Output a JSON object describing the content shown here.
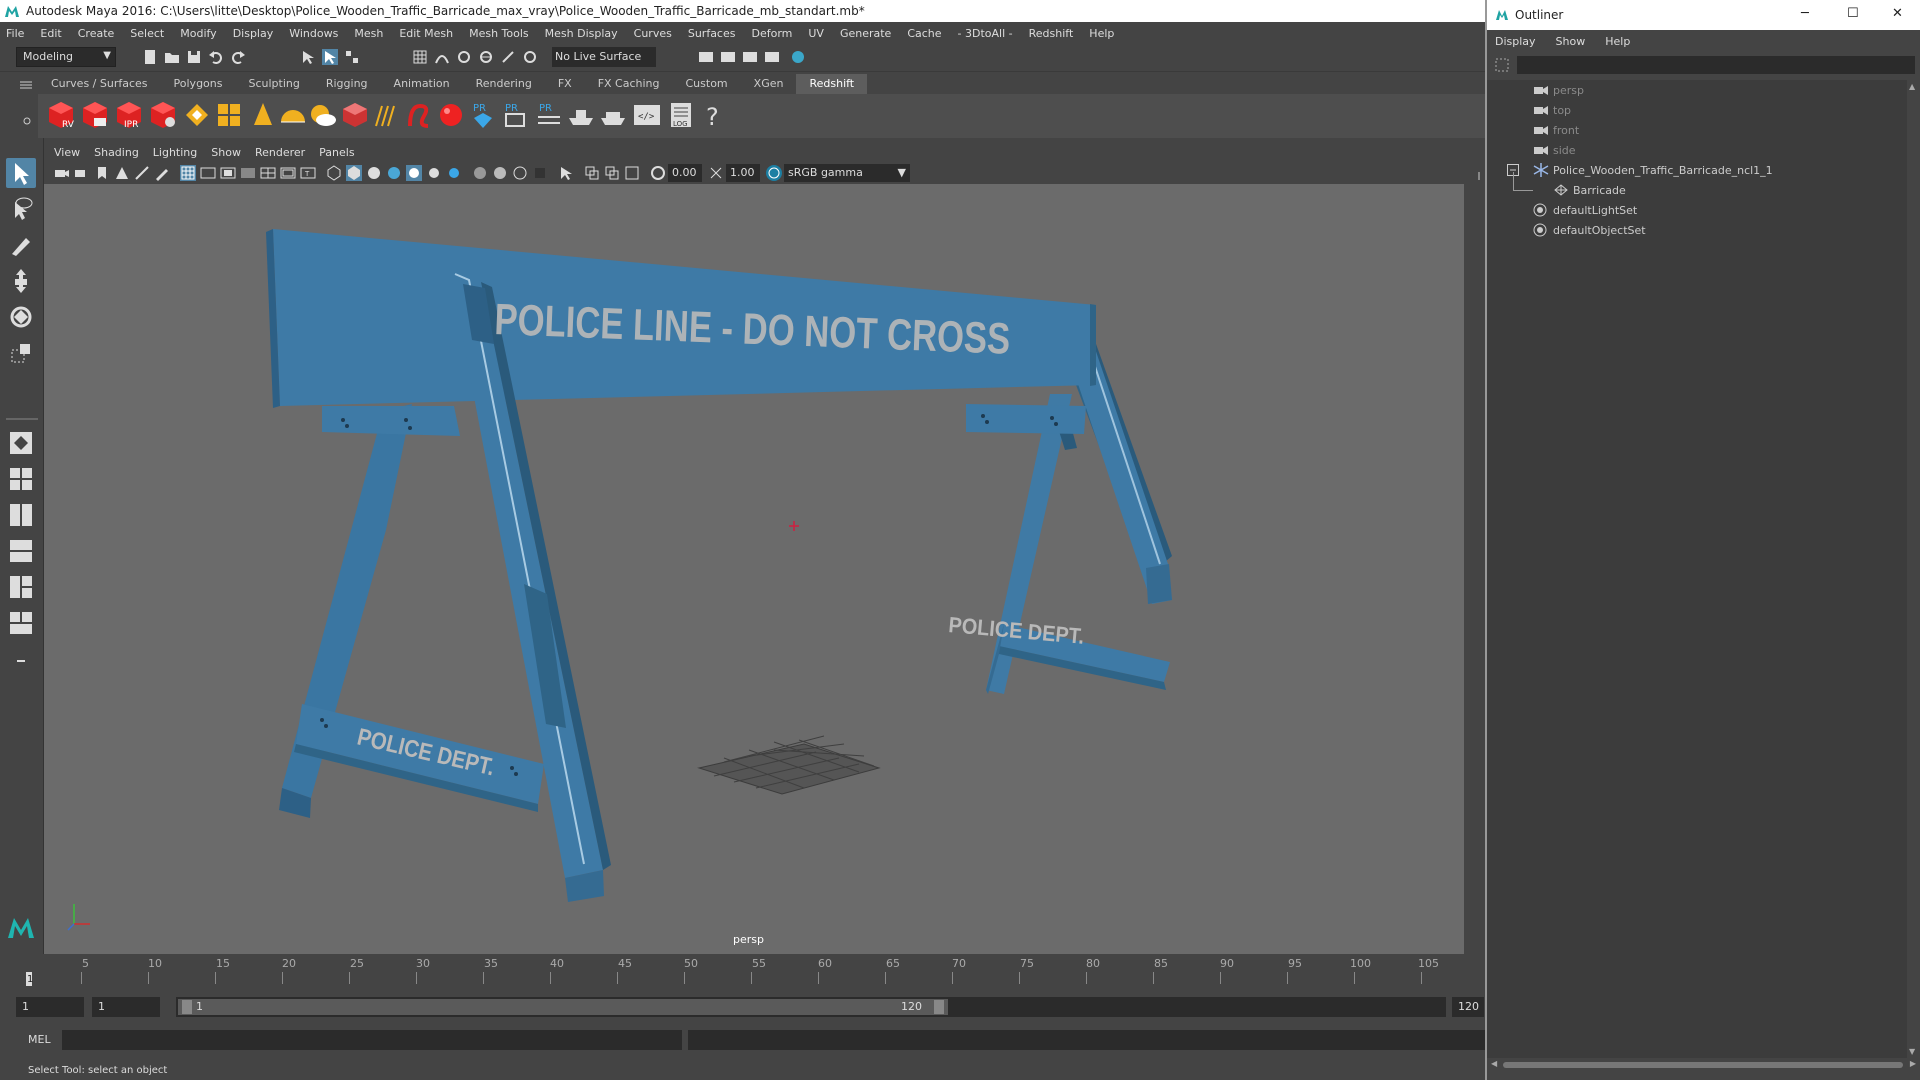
{
  "window": {
    "title": "Autodesk Maya 2016: C:\\Users\\litte\\Desktop\\Police_Wooden_Traffic_Barricade_max_vray\\Police_Wooden_Traffic_Barricade_mb_standart.mb*"
  },
  "menubar": [
    "File",
    "Edit",
    "Create",
    "Select",
    "Modify",
    "Display",
    "Windows",
    "Mesh",
    "Edit Mesh",
    "Mesh Tools",
    "Mesh Display",
    "Curves",
    "Surfaces",
    "Deform",
    "UV",
    "Generate",
    "Cache",
    "- 3DtoAll -",
    "Redshift",
    "Help"
  ],
  "statusline": {
    "mode": "Modeling",
    "live_surface": "No Live Surface"
  },
  "shelf": {
    "tabs": [
      "Curves / Surfaces",
      "Polygons",
      "Sculpting",
      "Rigging",
      "Animation",
      "Rendering",
      "FX",
      "FX Caching",
      "Custom",
      "XGen",
      "Redshift"
    ],
    "active_tab": "Redshift"
  },
  "panel": {
    "menus": [
      "View",
      "Shading",
      "Lighting",
      "Show",
      "Renderer",
      "Panels"
    ],
    "exposure": "0.00",
    "gamma": "1.00",
    "color_space": "sRGB gamma",
    "camera_label": "persp"
  },
  "barricade": {
    "plank_text": "POLICE LINE - DO NOT CROSS",
    "foot_text": "POLICE DEPT.",
    "color": "#3e7aa6"
  },
  "timeline": {
    "ticks": [
      5,
      10,
      15,
      20,
      25,
      30,
      35,
      40,
      45,
      50,
      55,
      60,
      65,
      70,
      75,
      80,
      85,
      90,
      95,
      100,
      105
    ],
    "current_frame": "1"
  },
  "range": {
    "start": "1",
    "current": "1",
    "range_start": "1",
    "range_end": "120",
    "end": "120"
  },
  "cmdline": {
    "lang": "MEL"
  },
  "helpline": "Select Tool: select an object",
  "outliner": {
    "title": "Outliner",
    "menus": [
      "Display",
      "Show",
      "Help"
    ],
    "items": [
      {
        "label": "persp",
        "type": "camera"
      },
      {
        "label": "top",
        "type": "camera"
      },
      {
        "label": "front",
        "type": "camera"
      },
      {
        "label": "side",
        "type": "camera"
      },
      {
        "label": "Police_Wooden_Traffic_Barricade_ncl1_1",
        "type": "group"
      },
      {
        "label": "Barricade",
        "type": "mesh"
      },
      {
        "label": "defaultLightSet",
        "type": "set"
      },
      {
        "label": "defaultObjectSet",
        "type": "set"
      }
    ]
  }
}
